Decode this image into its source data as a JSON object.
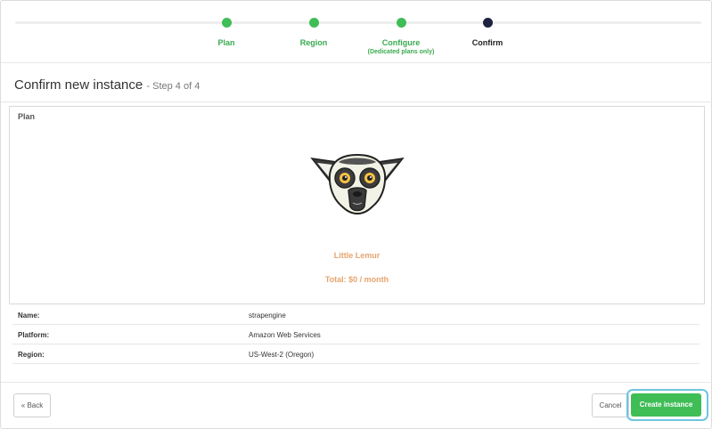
{
  "stepper": {
    "steps": [
      {
        "label": "Plan",
        "sub": ""
      },
      {
        "label": "Region",
        "sub": ""
      },
      {
        "label": "Configure",
        "sub": "(Dedicated plans only)"
      },
      {
        "label": "Confirm",
        "sub": ""
      }
    ],
    "current_step": 4,
    "colors": {
      "done": "#3fbd56",
      "current": "#1d2240"
    }
  },
  "heading": {
    "title": "Confirm new instance",
    "suffix": "- Step 4 of 4"
  },
  "plan": {
    "section_label": "Plan",
    "mascot_icon": "lemur-icon",
    "name": "Little Lemur",
    "total": "Total: $0 / month",
    "accent_color": "#e6a46e"
  },
  "details": [
    {
      "key": "Name:",
      "value": "strapengine"
    },
    {
      "key": "Platform:",
      "value": "Amazon Web Services"
    },
    {
      "key": "Region:",
      "value": "US-West-2 (Oregon)"
    }
  ],
  "actions": {
    "back_label": "« Back",
    "cancel_label": "Cancel",
    "create_label": "Create instance",
    "primary_color": "#3fbd56"
  }
}
